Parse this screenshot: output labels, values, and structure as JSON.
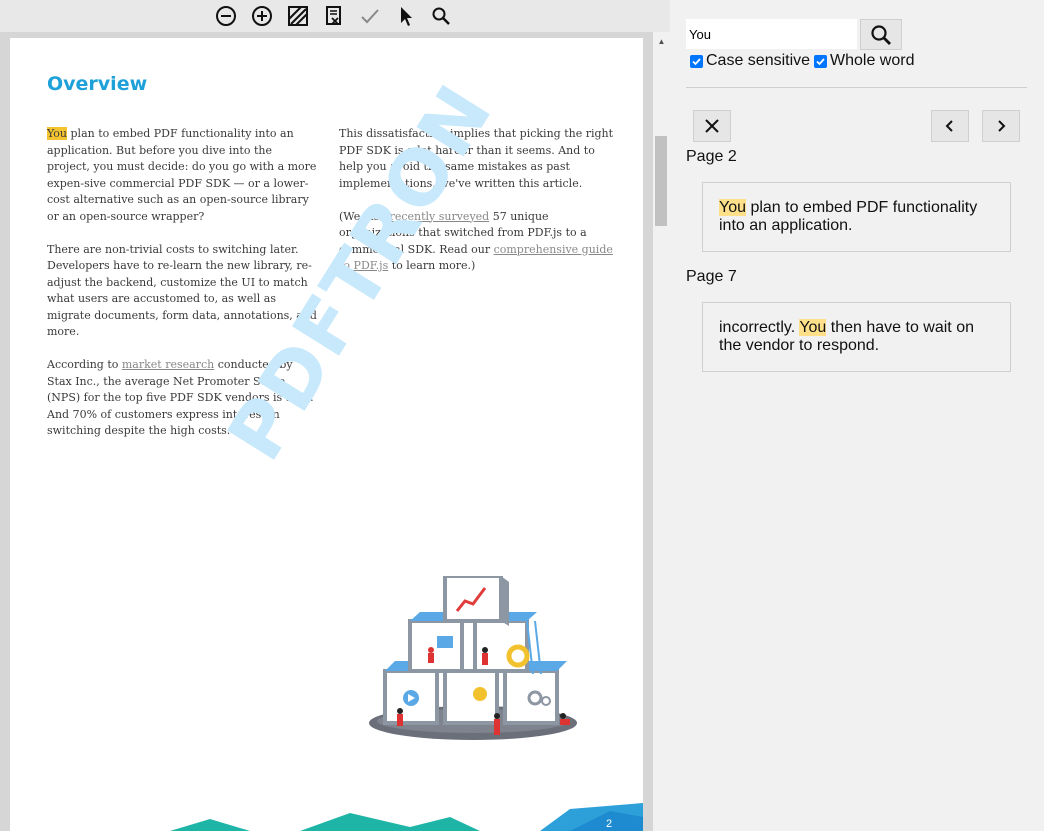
{
  "toolbar": {
    "icons": [
      "zoom-out-icon",
      "zoom-in-icon",
      "redact-icon",
      "apply-redaction-icon",
      "checkmark-icon",
      "pointer-icon",
      "search-icon"
    ]
  },
  "document": {
    "heading": "Overview",
    "page_number": "2",
    "watermark": "PDFTRON",
    "col1": {
      "p1_highlight": "You",
      "p1_rest": " plan to embed PDF functionality into an application. But before you dive into the project, you must decide: do you go with a more expen-sive commercial PDF SDK — or a lower-cost alternative such as an open-source library or an open-source wrapper?",
      "p2": "There are non-trivial costs to switching later. Developers have to re-learn the new library, re-adjust the backend, customize the UI to match what users are accustomed to, as well as migrate documents, form data, annotations, and more.",
      "p3_a": "According to ",
      "p3_link": "market research",
      "p3_b": " conducted by Stax Inc., the average Net Promoter Score (NPS) for the top five PDF SDK vendors is 35%. And 70% of customers express interest in switching despite the high costs."
    },
    "col2": {
      "p1": "This dissatisfaction implies that picking the right PDF SDK is a lot harder than it seems. And to help you avoid the same mistakes as past implementations, we've written this article.",
      "p2_a": "(We also ",
      "p2_link1": "recently surveyed",
      "p2_b": " 57 unique organizations that switched from PDF.js to a commercial SDK. Read our ",
      "p2_link2": "comprehensive guide to PDF.js",
      "p2_c": " to learn more.)"
    }
  },
  "search": {
    "query": "You",
    "case_sensitive_label": "Case sensitive",
    "whole_word_label": "Whole word",
    "case_sensitive": true,
    "whole_word": true
  },
  "results": [
    {
      "page_label": "Page 2",
      "before": "",
      "match": "You",
      "after": " plan to embed PDF functionality into an application."
    },
    {
      "page_label": "Page 7",
      "before": "incorrectly. ",
      "match": "You",
      "after": " then have to wait on the vendor to respond."
    }
  ],
  "colors": {
    "heading": "#1ea0d8",
    "highlight_doc": "#f4c430",
    "highlight_result": "#ffe08a",
    "checkbox": "#0075ff"
  }
}
